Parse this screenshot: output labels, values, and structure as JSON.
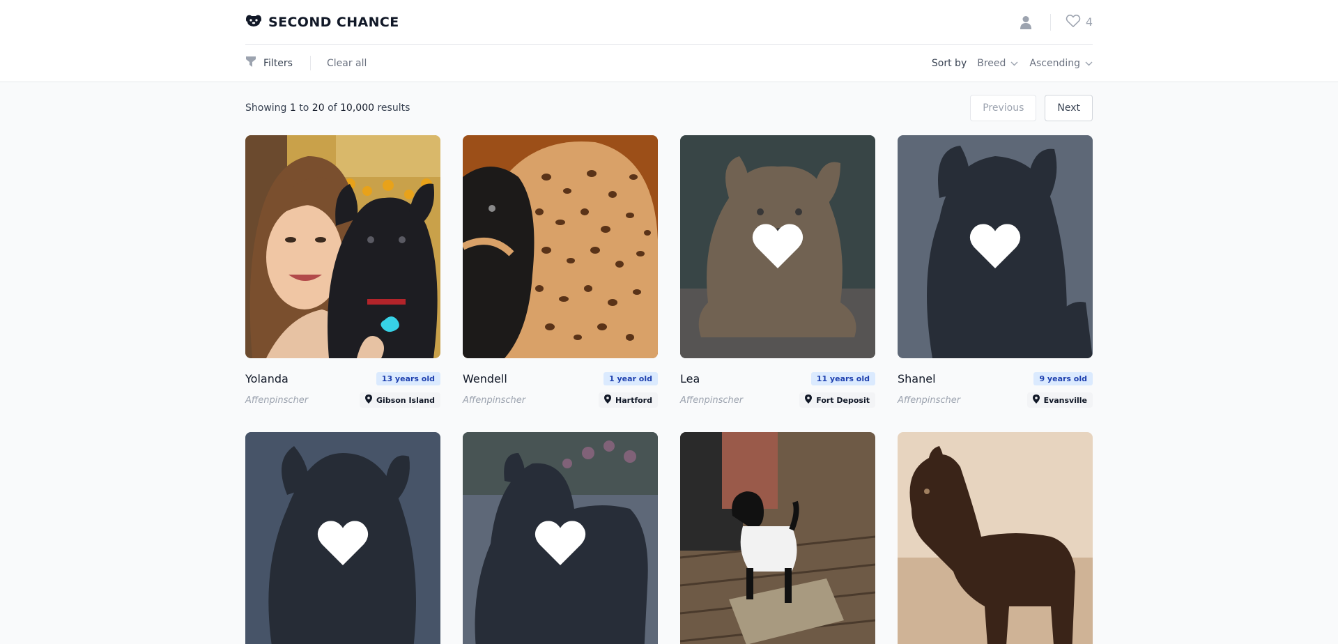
{
  "brand": {
    "title": "SECOND CHANCE",
    "icon": "dog-face-icon"
  },
  "header": {
    "favorites_count": "4",
    "user_icon": "user-icon",
    "favorites_icon": "heart-outline-icon"
  },
  "filters": {
    "filters_label": "Filters",
    "clear_all_label": "Clear all"
  },
  "sort": {
    "label": "Sort by",
    "field": "Breed",
    "order": "Ascending"
  },
  "results": {
    "prefix": "Showing",
    "from": "1",
    "to_word": "to",
    "to": "20",
    "of_word": "of",
    "total": "10,000",
    "suffix": "results"
  },
  "pagination": {
    "previous_label": "Previous",
    "next_label": "Next"
  },
  "colors": {
    "accent_badge_bg": "#dbeafe",
    "accent_badge_text": "#1e40af",
    "page_bg": "#f9fafb"
  },
  "dogs": [
    {
      "name": "Yolanda",
      "age": "13 years old",
      "breed": "Affenpinscher",
      "location": "Gibson Island",
      "favorited": false
    },
    {
      "name": "Wendell",
      "age": "1 year old",
      "breed": "Affenpinscher",
      "location": "Hartford",
      "favorited": false
    },
    {
      "name": "Lea",
      "age": "11 years old",
      "breed": "Affenpinscher",
      "location": "Fort Deposit",
      "favorited": true
    },
    {
      "name": "Shanel",
      "age": "9 years old",
      "breed": "Affenpinscher",
      "location": "Evansville",
      "favorited": true
    },
    {
      "name": "",
      "age": "",
      "breed": "",
      "location": "",
      "favorited": true
    },
    {
      "name": "",
      "age": "",
      "breed": "",
      "location": "",
      "favorited": true
    },
    {
      "name": "",
      "age": "",
      "breed": "",
      "location": "",
      "favorited": false
    },
    {
      "name": "",
      "age": "",
      "breed": "",
      "location": "",
      "favorited": false
    }
  ]
}
